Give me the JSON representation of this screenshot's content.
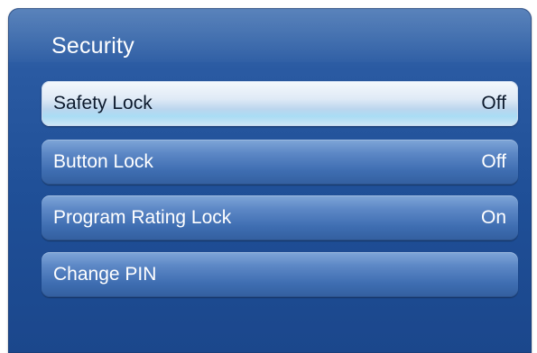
{
  "menu": {
    "title": "Security",
    "items": [
      {
        "label": "Safety Lock",
        "value": "Off",
        "selected": true
      },
      {
        "label": "Button Lock",
        "value": "Off",
        "selected": false
      },
      {
        "label": "Program Rating Lock",
        "value": "On",
        "selected": false
      },
      {
        "label": "Change PIN",
        "value": "",
        "selected": false
      }
    ]
  },
  "colors": {
    "panel_blue": "#2a5aa2",
    "item_blue": "#5d88c6",
    "selected_highlight": "#bcd6ee"
  }
}
